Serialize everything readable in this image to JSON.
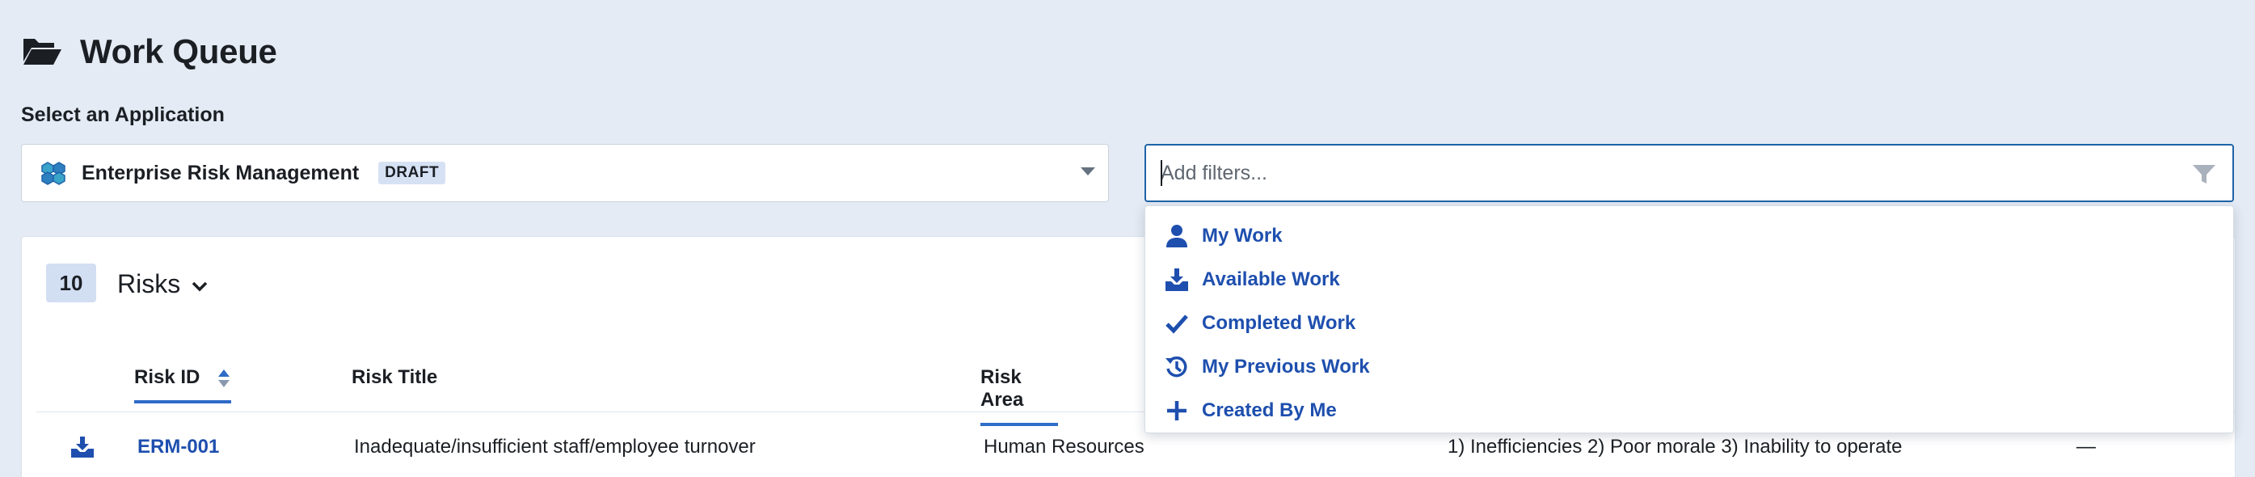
{
  "header": {
    "title": "Work Queue"
  },
  "app_select": {
    "label": "Select an Application",
    "selected": "Enterprise Risk Management",
    "badge": "DRAFT"
  },
  "filters": {
    "placeholder": "Add filters...",
    "options": [
      {
        "label": "My Work",
        "icon": "user-icon"
      },
      {
        "label": "Available Work",
        "icon": "inbox-download-icon"
      },
      {
        "label": "Completed Work",
        "icon": "checkmark-icon"
      },
      {
        "label": "My Previous Work",
        "icon": "history-icon"
      },
      {
        "label": "Created By Me",
        "icon": "plus-icon"
      }
    ]
  },
  "list": {
    "count": "10",
    "title": "Risks",
    "columns": {
      "risk_id": "Risk ID",
      "risk_title": "Risk Title",
      "risk_area": "Risk Area"
    },
    "rows": [
      {
        "id": "ERM-001",
        "title": "Inadequate/insufficient staff/employee turnover",
        "area": "Human Resources",
        "impact": "1) Inefficiencies 2) Poor morale 3) Inability to operate",
        "extra": "—"
      }
    ]
  },
  "colors": {
    "accent": "#1e4fae",
    "background": "#e4ebf4",
    "badge": "#d2def2"
  }
}
